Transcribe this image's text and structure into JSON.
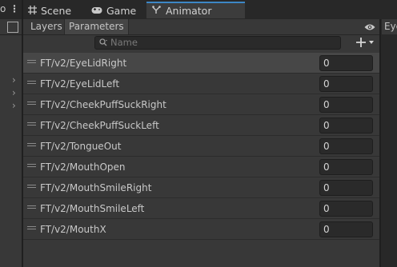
{
  "left_panel": {
    "tab_stub": "o"
  },
  "tabs": [
    {
      "label": "Scene",
      "icon": "grid-icon"
    },
    {
      "label": "Game",
      "icon": "gamepad-icon"
    },
    {
      "label": "Animator",
      "icon": "animator-icon"
    }
  ],
  "subtabs": {
    "layers": "Layers",
    "parameters": "Parameters"
  },
  "search": {
    "placeholder": "Name"
  },
  "parameters": [
    {
      "name": "FT/v2/EyeLidRight",
      "value": "0"
    },
    {
      "name": "FT/v2/EyeLidLeft",
      "value": "0"
    },
    {
      "name": "FT/v2/CheekPuffSuckRight",
      "value": "0"
    },
    {
      "name": "FT/v2/CheekPuffSuckLeft",
      "value": "0"
    },
    {
      "name": "FT/v2/TongueOut",
      "value": "0"
    },
    {
      "name": "FT/v2/MouthOpen",
      "value": "0"
    },
    {
      "name": "FT/v2/MouthSmileRight",
      "value": "0"
    },
    {
      "name": "FT/v2/MouthSmileLeft",
      "value": "0"
    },
    {
      "name": "FT/v2/MouthX",
      "value": "0"
    }
  ],
  "right_panel": {
    "tab_stub": "Eye"
  },
  "colors": {
    "accent": "#3d87c6",
    "panel": "#383838",
    "tabbar": "#282828"
  }
}
